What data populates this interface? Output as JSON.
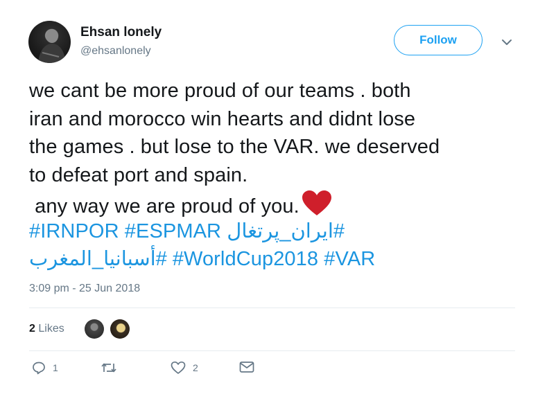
{
  "user": {
    "display_name": "Ehsan lonely",
    "handle": "@ehsanlonely"
  },
  "follow_label": "Follow",
  "tweet": {
    "lines": [
      "we cant be more proud of our teams . both",
      "iran and morocco win hearts and didnt lose",
      "the games . but lose to the VAR. we deserved",
      "to defeat port and spain.",
      " any way we are proud of you."
    ],
    "hashtags_line1": [
      "#IRNPOR",
      "#ESPMAR",
      "#ایران_پرتغال"
    ],
    "hashtags_line2": [
      "#أسبانيا_المغرب",
      "#WorldCup2018",
      "#VAR"
    ]
  },
  "timestamp": "3:09 pm - 25 Jun 2018",
  "likes": {
    "count": "2",
    "label": "Likes"
  },
  "actions": {
    "reply_count": "1",
    "retweet_count": "",
    "like_count": "2"
  },
  "colors": {
    "link": "#1b95e0",
    "follow": "#1da1f2",
    "muted": "#657786",
    "heart": "#cf1f2b"
  },
  "icons": [
    "caret-down-icon",
    "red-heart-emoji",
    "reply-icon",
    "retweet-icon",
    "like-icon",
    "message-icon"
  ]
}
